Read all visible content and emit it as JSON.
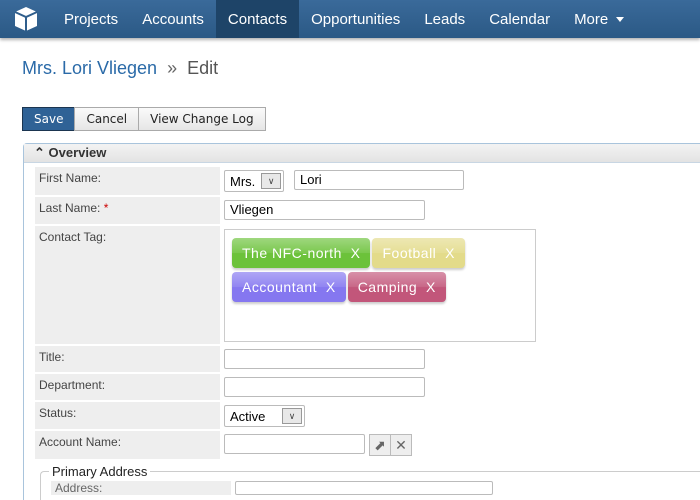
{
  "nav": {
    "items": [
      {
        "label": "Projects"
      },
      {
        "label": "Accounts"
      },
      {
        "label": "Contacts",
        "active": true
      },
      {
        "label": "Opportunities"
      },
      {
        "label": "Leads"
      },
      {
        "label": "Calendar"
      },
      {
        "label": "More"
      }
    ]
  },
  "breadcrumb": {
    "name": "Mrs. Lori Vliegen",
    "sep": "»",
    "action": "Edit"
  },
  "toolbar": {
    "save": "Save",
    "cancel": "Cancel",
    "log": "View Change Log"
  },
  "panel": {
    "title": "Overview"
  },
  "form": {
    "first_name_label": "First Name:",
    "salutation": "Mrs.",
    "first_name": "Lori",
    "last_name_label": "Last Name:",
    "required": "*",
    "last_name": "Vliegen",
    "tag_label": "Contact Tag:",
    "tags": [
      {
        "label": "The NFC-north",
        "remove": "X",
        "color": "#6cc23a"
      },
      {
        "label": "Football",
        "remove": "X",
        "color": "#e3db8a"
      },
      {
        "label": "Accountant",
        "remove": "X",
        "color": "#8577f0"
      },
      {
        "label": "Camping",
        "remove": "X",
        "color": "#c2567a"
      }
    ],
    "title_label": "Title:",
    "title": "",
    "department_label": "Department:",
    "department": "",
    "status_label": "Status:",
    "status": "Active",
    "account_label": "Account Name:",
    "account": "",
    "address_legend": "Primary Address",
    "address_label": "Address:"
  }
}
